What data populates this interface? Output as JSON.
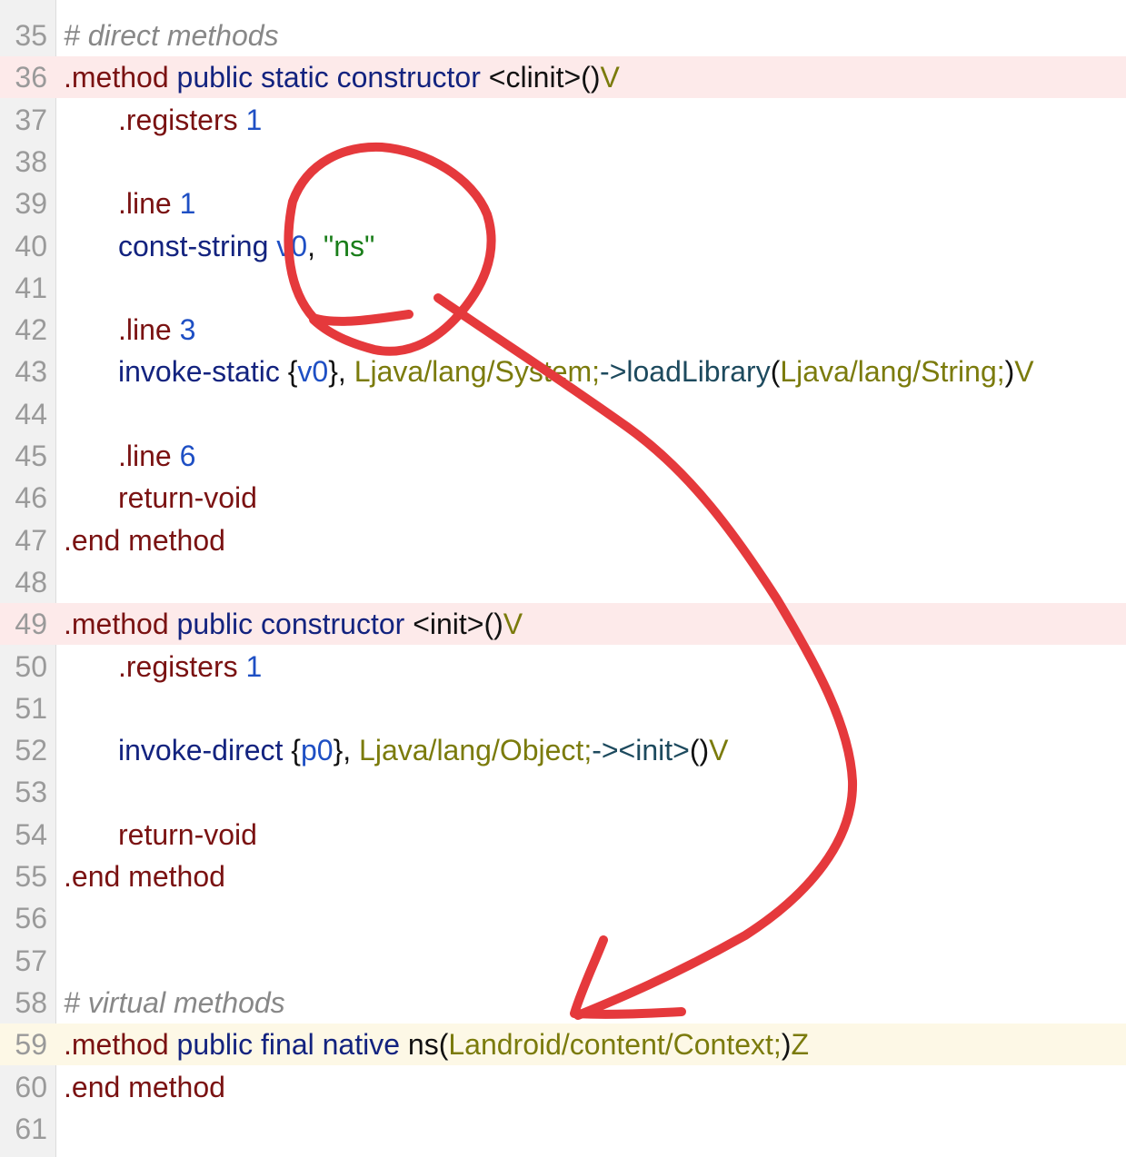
{
  "editor": {
    "lines": [
      {
        "n": "35",
        "hl": "",
        "indent": false,
        "tokens": [
          {
            "c": "t-com",
            "t": "# direct methods"
          }
        ]
      },
      {
        "n": "36",
        "hl": "hl-red",
        "indent": false,
        "tokens": [
          {
            "c": "t-dir",
            "t": ".method"
          },
          {
            "c": "t-plain",
            "t": " "
          },
          {
            "c": "t-kw",
            "t": "public"
          },
          {
            "c": "t-plain",
            "t": " "
          },
          {
            "c": "t-kw",
            "t": "static"
          },
          {
            "c": "t-plain",
            "t": " "
          },
          {
            "c": "t-kw",
            "t": "constructor"
          },
          {
            "c": "t-plain",
            "t": " <clinit>()"
          },
          {
            "c": "t-type",
            "t": "V"
          }
        ]
      },
      {
        "n": "37",
        "hl": "",
        "indent": true,
        "tokens": [
          {
            "c": "t-dir",
            "t": ".registers"
          },
          {
            "c": "t-plain",
            "t": " "
          },
          {
            "c": "t-num",
            "t": "1"
          }
        ]
      },
      {
        "n": "38",
        "hl": "",
        "indent": true,
        "tokens": []
      },
      {
        "n": "39",
        "hl": "",
        "indent": true,
        "tokens": [
          {
            "c": "t-dir",
            "t": ".line"
          },
          {
            "c": "t-plain",
            "t": " "
          },
          {
            "c": "t-num",
            "t": "1"
          }
        ]
      },
      {
        "n": "40",
        "hl": "",
        "indent": true,
        "tokens": [
          {
            "c": "t-kw",
            "t": "const-string"
          },
          {
            "c": "t-plain",
            "t": " "
          },
          {
            "c": "t-num",
            "t": "v0"
          },
          {
            "c": "t-plain",
            "t": ", "
          },
          {
            "c": "t-str",
            "t": "\"ns\""
          }
        ]
      },
      {
        "n": "41",
        "hl": "",
        "indent": true,
        "tokens": []
      },
      {
        "n": "42",
        "hl": "",
        "indent": true,
        "tokens": [
          {
            "c": "t-dir",
            "t": ".line"
          },
          {
            "c": "t-plain",
            "t": " "
          },
          {
            "c": "t-num",
            "t": "3"
          }
        ]
      },
      {
        "n": "43",
        "hl": "",
        "indent": true,
        "tokens": [
          {
            "c": "t-kw",
            "t": "invoke-static"
          },
          {
            "c": "t-plain",
            "t": " {"
          },
          {
            "c": "t-num",
            "t": "v0"
          },
          {
            "c": "t-plain",
            "t": "}, "
          },
          {
            "c": "t-type",
            "t": "Ljava/lang/System;"
          },
          {
            "c": "t-meth",
            "t": "->loadLibrary"
          },
          {
            "c": "t-plain",
            "t": "("
          },
          {
            "c": "t-type",
            "t": "Ljava/lang/String;"
          },
          {
            "c": "t-plain",
            "t": ")"
          },
          {
            "c": "t-type",
            "t": "V"
          }
        ]
      },
      {
        "n": "44",
        "hl": "",
        "indent": true,
        "tokens": []
      },
      {
        "n": "45",
        "hl": "",
        "indent": true,
        "tokens": [
          {
            "c": "t-dir",
            "t": ".line"
          },
          {
            "c": "t-plain",
            "t": " "
          },
          {
            "c": "t-num",
            "t": "6"
          }
        ]
      },
      {
        "n": "46",
        "hl": "",
        "indent": true,
        "tokens": [
          {
            "c": "t-dir",
            "t": "return-void"
          }
        ]
      },
      {
        "n": "47",
        "hl": "",
        "indent": false,
        "tokens": [
          {
            "c": "t-dir",
            "t": ".end method"
          }
        ]
      },
      {
        "n": "48",
        "hl": "",
        "indent": false,
        "tokens": []
      },
      {
        "n": "49",
        "hl": "hl-red",
        "indent": false,
        "tokens": [
          {
            "c": "t-dir",
            "t": ".method"
          },
          {
            "c": "t-plain",
            "t": " "
          },
          {
            "c": "t-kw",
            "t": "public"
          },
          {
            "c": "t-plain",
            "t": " "
          },
          {
            "c": "t-kw",
            "t": "constructor"
          },
          {
            "c": "t-plain",
            "t": " <init>()"
          },
          {
            "c": "t-type",
            "t": "V"
          }
        ]
      },
      {
        "n": "50",
        "hl": "",
        "indent": true,
        "tokens": [
          {
            "c": "t-dir",
            "t": ".registers"
          },
          {
            "c": "t-plain",
            "t": " "
          },
          {
            "c": "t-num",
            "t": "1"
          }
        ]
      },
      {
        "n": "51",
        "hl": "",
        "indent": true,
        "tokens": []
      },
      {
        "n": "52",
        "hl": "",
        "indent": true,
        "tokens": [
          {
            "c": "t-kw",
            "t": "invoke-direct"
          },
          {
            "c": "t-plain",
            "t": " {"
          },
          {
            "c": "t-num",
            "t": "p0"
          },
          {
            "c": "t-plain",
            "t": "}, "
          },
          {
            "c": "t-type",
            "t": "Ljava/lang/Object;"
          },
          {
            "c": "t-meth",
            "t": "-><init>"
          },
          {
            "c": "t-plain",
            "t": "()"
          },
          {
            "c": "t-type",
            "t": "V"
          }
        ]
      },
      {
        "n": "53",
        "hl": "",
        "indent": true,
        "tokens": []
      },
      {
        "n": "54",
        "hl": "",
        "indent": true,
        "tokens": [
          {
            "c": "t-dir",
            "t": "return-void"
          }
        ]
      },
      {
        "n": "55",
        "hl": "",
        "indent": false,
        "tokens": [
          {
            "c": "t-dir",
            "t": ".end method"
          }
        ]
      },
      {
        "n": "56",
        "hl": "",
        "indent": false,
        "tokens": []
      },
      {
        "n": "57",
        "hl": "",
        "indent": false,
        "tokens": []
      },
      {
        "n": "58",
        "hl": "",
        "indent": false,
        "tokens": [
          {
            "c": "t-com",
            "t": "# virtual methods"
          }
        ]
      },
      {
        "n": "59",
        "hl": "hl-yellow",
        "indent": false,
        "tokens": [
          {
            "c": "t-dir",
            "t": ".method"
          },
          {
            "c": "t-plain",
            "t": " "
          },
          {
            "c": "t-kw",
            "t": "public"
          },
          {
            "c": "t-plain",
            "t": " "
          },
          {
            "c": "t-kw",
            "t": "final"
          },
          {
            "c": "t-plain",
            "t": " "
          },
          {
            "c": "t-kw",
            "t": "native"
          },
          {
            "c": "t-plain",
            "t": " ns("
          },
          {
            "c": "t-type",
            "t": "Landroid/content/Context;"
          },
          {
            "c": "t-plain",
            "t": ")"
          },
          {
            "c": "t-type",
            "t": "Z"
          }
        ]
      },
      {
        "n": "60",
        "hl": "",
        "indent": false,
        "tokens": [
          {
            "c": "t-dir",
            "t": ".end method"
          }
        ]
      },
      {
        "n": "61",
        "hl": "",
        "indent": false,
        "tokens": []
      }
    ]
  },
  "annotation": {
    "color": "#e5393c",
    "shapes": [
      "circle-around-v0-ns",
      "curved-arrow-to-native-ns"
    ]
  }
}
